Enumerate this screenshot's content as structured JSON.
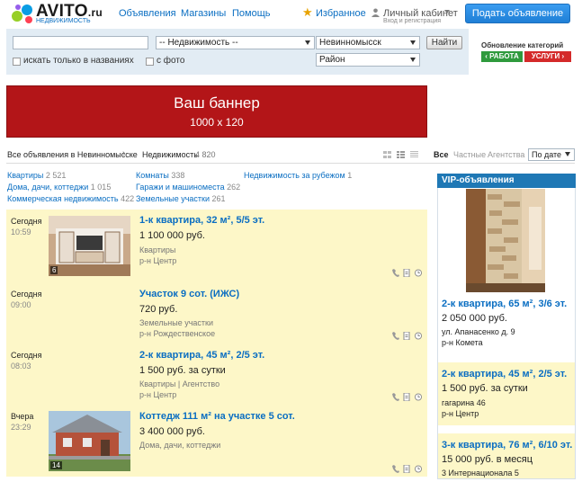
{
  "header": {
    "logo_text": "AVITO",
    "logo_tld": ".ru",
    "logo_sub": "НЕДВИЖИМОСТЬ",
    "nav": [
      "Объявления",
      "Магазины",
      "Помощь"
    ],
    "favorites": "Избранное",
    "account": "Личный кабинет",
    "account_sub": "Вход и регистрация",
    "post_button": "Подать объявление"
  },
  "search": {
    "query_value": "",
    "category": "-- Недвижимость --",
    "find_button": "Найти",
    "city": "Невинномысск",
    "district": "Район",
    "titles_only": "искать только в названиях",
    "with_photo": "с фото"
  },
  "updates": {
    "title": "Обновление категорий",
    "work": "РАБОТА",
    "services": "УСЛУГИ",
    "work_color": "#2f9a3d",
    "services_color": "#d42a2a"
  },
  "banner": {
    "title": "Ваш баннер",
    "size": "1000 x 120",
    "color": "#b31518"
  },
  "breadcrumb": {
    "all": "Все объявления в Невинномысске",
    "separator": "›",
    "category": "Недвижимость",
    "count": "4 820"
  },
  "filters": {
    "all": "Все",
    "private": "Частные",
    "agencies": "Агентства",
    "sort": "По дате"
  },
  "subcategories": [
    {
      "label": "Квартиры",
      "count": "2 521"
    },
    {
      "label": "Дома, дачи, коттеджи",
      "count": "1 015"
    },
    {
      "label": "Коммерческая недвижимость",
      "count": "422"
    },
    {
      "label": "Комнаты",
      "count": "338"
    },
    {
      "label": "Гаражи и машиноместа",
      "count": "262"
    },
    {
      "label": "Земельные участки",
      "count": "261"
    },
    {
      "label": "Недвижимость за рубежом",
      "count": "1"
    }
  ],
  "listings": [
    {
      "date": "Сегодня",
      "time": "10:59",
      "title": "1-к квартира, 32 м², 5/5 эт.",
      "price": "1 100 000 руб.",
      "meta1": "Квартиры",
      "meta2": "р-н Центр",
      "photo_count": "6"
    },
    {
      "date": "Сегодня",
      "time": "09:00",
      "title": "Участок 9 сот. (ИЖС)",
      "price": "720 руб.",
      "meta1": "Земельные участки",
      "meta2": "р-н Рождественское"
    },
    {
      "date": "Сегодня",
      "time": "08:03",
      "title": "2-к квартира, 45 м², 2/5 эт.",
      "price": "1 500 руб. за сутки",
      "meta1": "Квартиры | Агентство",
      "meta2": "р-н Центр"
    },
    {
      "date": "Вчера",
      "time": "23:29",
      "title": "Коттедж 111 м² на участке 5 сот.",
      "price": "3 400 000 руб.",
      "meta1": "Дома, дачи, коттеджи",
      "photo_count": "14"
    }
  ],
  "vip": {
    "header": "VIP-объявления",
    "items": [
      {
        "title": "2-к квартира, 65 м², 3/6 эт.",
        "price": "2 050 000 руб.",
        "address": "ул. Апанасенко д. 9",
        "district": "р-н Комета"
      },
      {
        "title": "2-к квартира, 45 м², 2/5 эт.",
        "price": "1 500 руб. за сутки",
        "address": "гагарина 46",
        "district": "р-н Центр"
      },
      {
        "title": "3-к квартира, 76 м², 6/10 эт.",
        "price": "15 000 руб. в месяц",
        "address": "3 Интернационала 5"
      }
    ]
  }
}
